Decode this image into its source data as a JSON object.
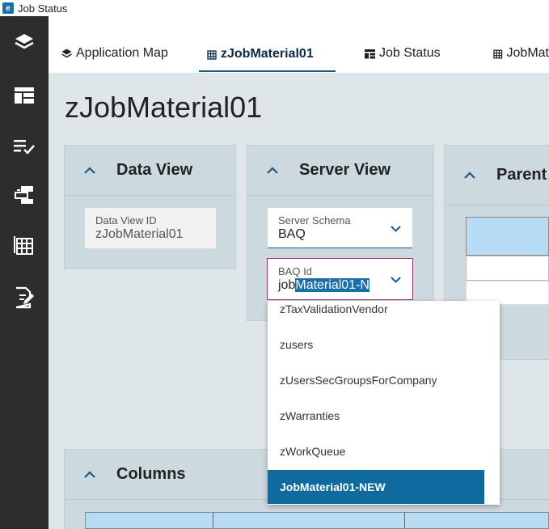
{
  "window": {
    "title": "Job Status",
    "logo_letter": "e"
  },
  "sidebar": {
    "items": [
      {
        "icon": "layers-icon"
      },
      {
        "icon": "dashboard-layout-icon"
      },
      {
        "icon": "checklist-icon"
      },
      {
        "icon": "data-flow-icon"
      },
      {
        "icon": "grid-icon"
      },
      {
        "icon": "edit-document-icon"
      }
    ]
  },
  "tabs": [
    {
      "label": "Application Map",
      "icon": "layers-icon",
      "active": false
    },
    {
      "label": "zJobMaterial01",
      "icon": "grid-icon",
      "active": true
    },
    {
      "label": "Job Status",
      "icon": "layout-icon",
      "active": false
    },
    {
      "label": "JobMat",
      "icon": "grid-icon",
      "active": false
    }
  ],
  "page": {
    "title": "zJobMaterial01"
  },
  "panels": {
    "data_view": {
      "title": "Data View",
      "data_view_id": {
        "label": "Data View ID",
        "value": "zJobMaterial01"
      }
    },
    "server_view": {
      "title": "Server View",
      "server_schema": {
        "label": "Server Schema",
        "value": "BAQ"
      },
      "baq_id": {
        "label": "BAQ Id",
        "value_plain": "job",
        "value_selected": "Material01-N"
      }
    },
    "parent": {
      "title": "Parent"
    },
    "columns": {
      "title": "Columns"
    }
  },
  "baq_dropdown": {
    "options": [
      "zTaxValidationVendor",
      "zusers",
      "zUsersSecGroupsForCompany",
      "zWarranties",
      "zWorkQueue",
      "JobMaterial01-NEW"
    ],
    "selected": "JobMaterial01-NEW"
  },
  "colors": {
    "sidebar_bg": "#2d2d2d",
    "accent": "#1b6fa8",
    "selected_option_bg": "#0f6a9f",
    "panel_bg": "#ccd9de",
    "grid_header_bg": "#b9dcf5"
  }
}
